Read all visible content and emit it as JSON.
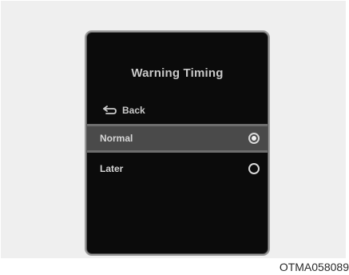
{
  "screen": {
    "title": "Warning Timing",
    "back": {
      "label": "Back",
      "icon": "back-arrow-icon"
    },
    "options": [
      {
        "label": "Normal",
        "selected": true
      },
      {
        "label": "Later",
        "selected": false
      }
    ]
  },
  "caption": "OTMA058089",
  "colors": {
    "screen_bg": "#0b0b0b",
    "highlight_bg": "#4a4a4a",
    "text": "#c9c9c9",
    "page_bg": "#efefef"
  }
}
